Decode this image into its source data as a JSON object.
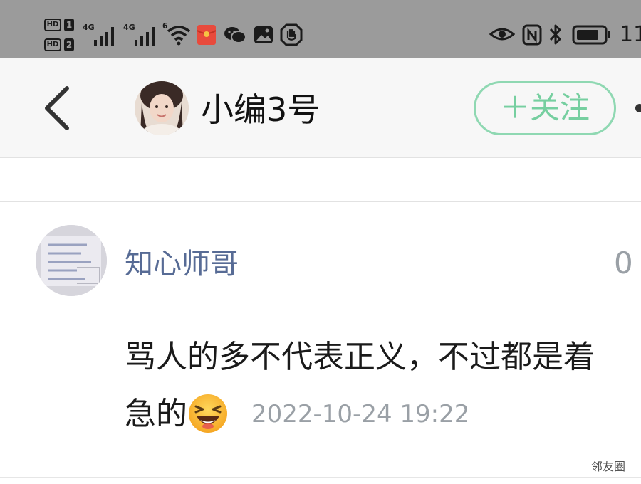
{
  "status_bar": {
    "hd1_label": "HD",
    "hd1_num": "1",
    "hd2_label": "HD",
    "hd2_num": "2",
    "sim1_label": "4G",
    "sim2_label": "4G",
    "wifi_label": "6",
    "time_partial": "11",
    "icons": [
      "hd-icon",
      "signal-icon",
      "signal-icon",
      "wifi-icon",
      "red-packet-icon",
      "wechat-icon",
      "gallery-icon",
      "hand-icon",
      "eye-icon",
      "nfc-icon",
      "bluetooth-icon",
      "battery-icon"
    ]
  },
  "header": {
    "back_icon": "chevron-left-icon",
    "title": "小编3号",
    "follow_label": "＋关注",
    "more_icon": "more-dots-icon"
  },
  "comment": {
    "author": "知心师哥",
    "count": "0",
    "text_line1": "骂人的多不代表正义，不过都是着",
    "text_line2": "急的",
    "emoji": "laughing-emoji",
    "timestamp": "2022-10-24 19:22"
  },
  "watermark": "邻友圈",
  "colors": {
    "status_bar": "#9b9b9b",
    "nav_bg": "#f7f7f7",
    "follow_accent": "#76cfa0",
    "author_link": "#576b95",
    "muted": "#9aa0a6"
  }
}
